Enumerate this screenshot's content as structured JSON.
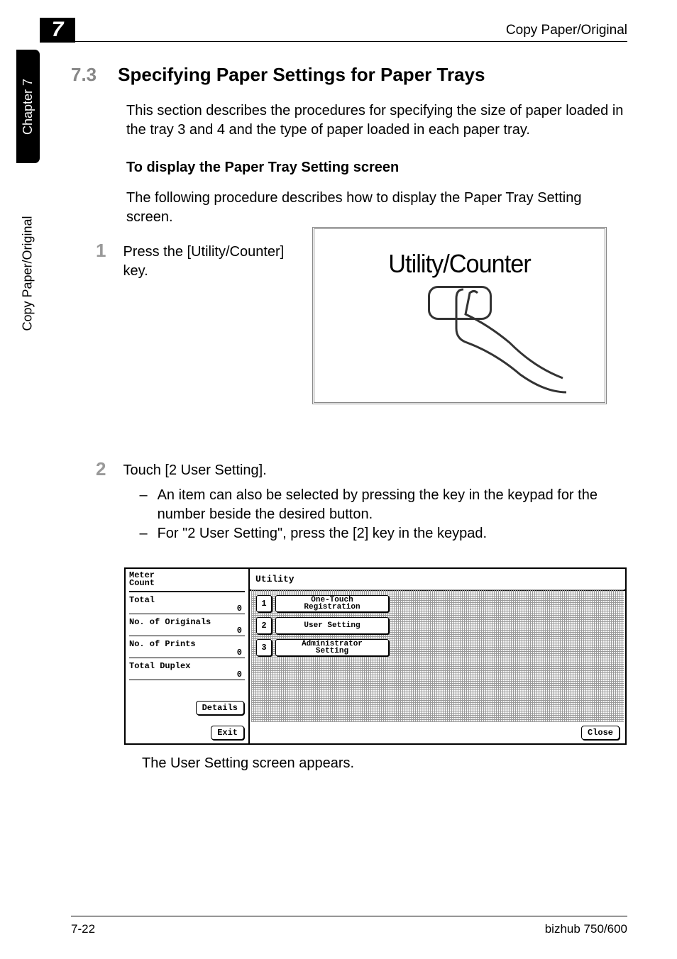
{
  "header": {
    "title": "Copy Paper/Original",
    "chapter_badge": "7"
  },
  "side": {
    "chapter_tab": "Chapter 7",
    "section_tab": "Copy Paper/Original"
  },
  "section": {
    "number": "7.3",
    "title": "Specifying Paper Settings for Paper Trays",
    "intro": "This section describes the procedures for specifying the size of paper loaded in the tray 3 and 4 and the type of paper loaded in each paper tray.",
    "sub_heading": "To display the Paper Tray Setting screen",
    "sub_body": "The following procedure describes how to display the Paper Tray Setting screen."
  },
  "steps": {
    "s1_num": "1",
    "s1_text": "Press the [Utility/Counter] key.",
    "s2_num": "2",
    "s2_text": "Touch [2 User Setting].",
    "s2_b1": "An item can also be selected by pressing the key in the keypad for the number beside the desired button.",
    "s2_b2": "For \"2 User Setting\", press the [2] key in the keypad."
  },
  "figure1": {
    "label": "Utility/Counter"
  },
  "screen": {
    "meter_header": "Meter\nCount",
    "total_label": "Total",
    "total_val": "0",
    "orig_label": "No. of Originals",
    "orig_val": "0",
    "prints_label": "No. of Prints",
    "prints_val": "0",
    "duplex_label": "Total Duplex",
    "duplex_val": "0",
    "details_btn": "Details",
    "exit_btn": "Exit",
    "utility_header": "Utility",
    "menu1_num": "1",
    "menu1_label": "One-Touch\nRegistration",
    "menu2_num": "2",
    "menu2_label": "User Setting",
    "menu3_num": "3",
    "menu3_label": "Administrator\nSetting",
    "close_btn": "Close"
  },
  "after_screen": "The User Setting screen appears.",
  "footer": {
    "left": "7-22",
    "right": "bizhub 750/600"
  }
}
